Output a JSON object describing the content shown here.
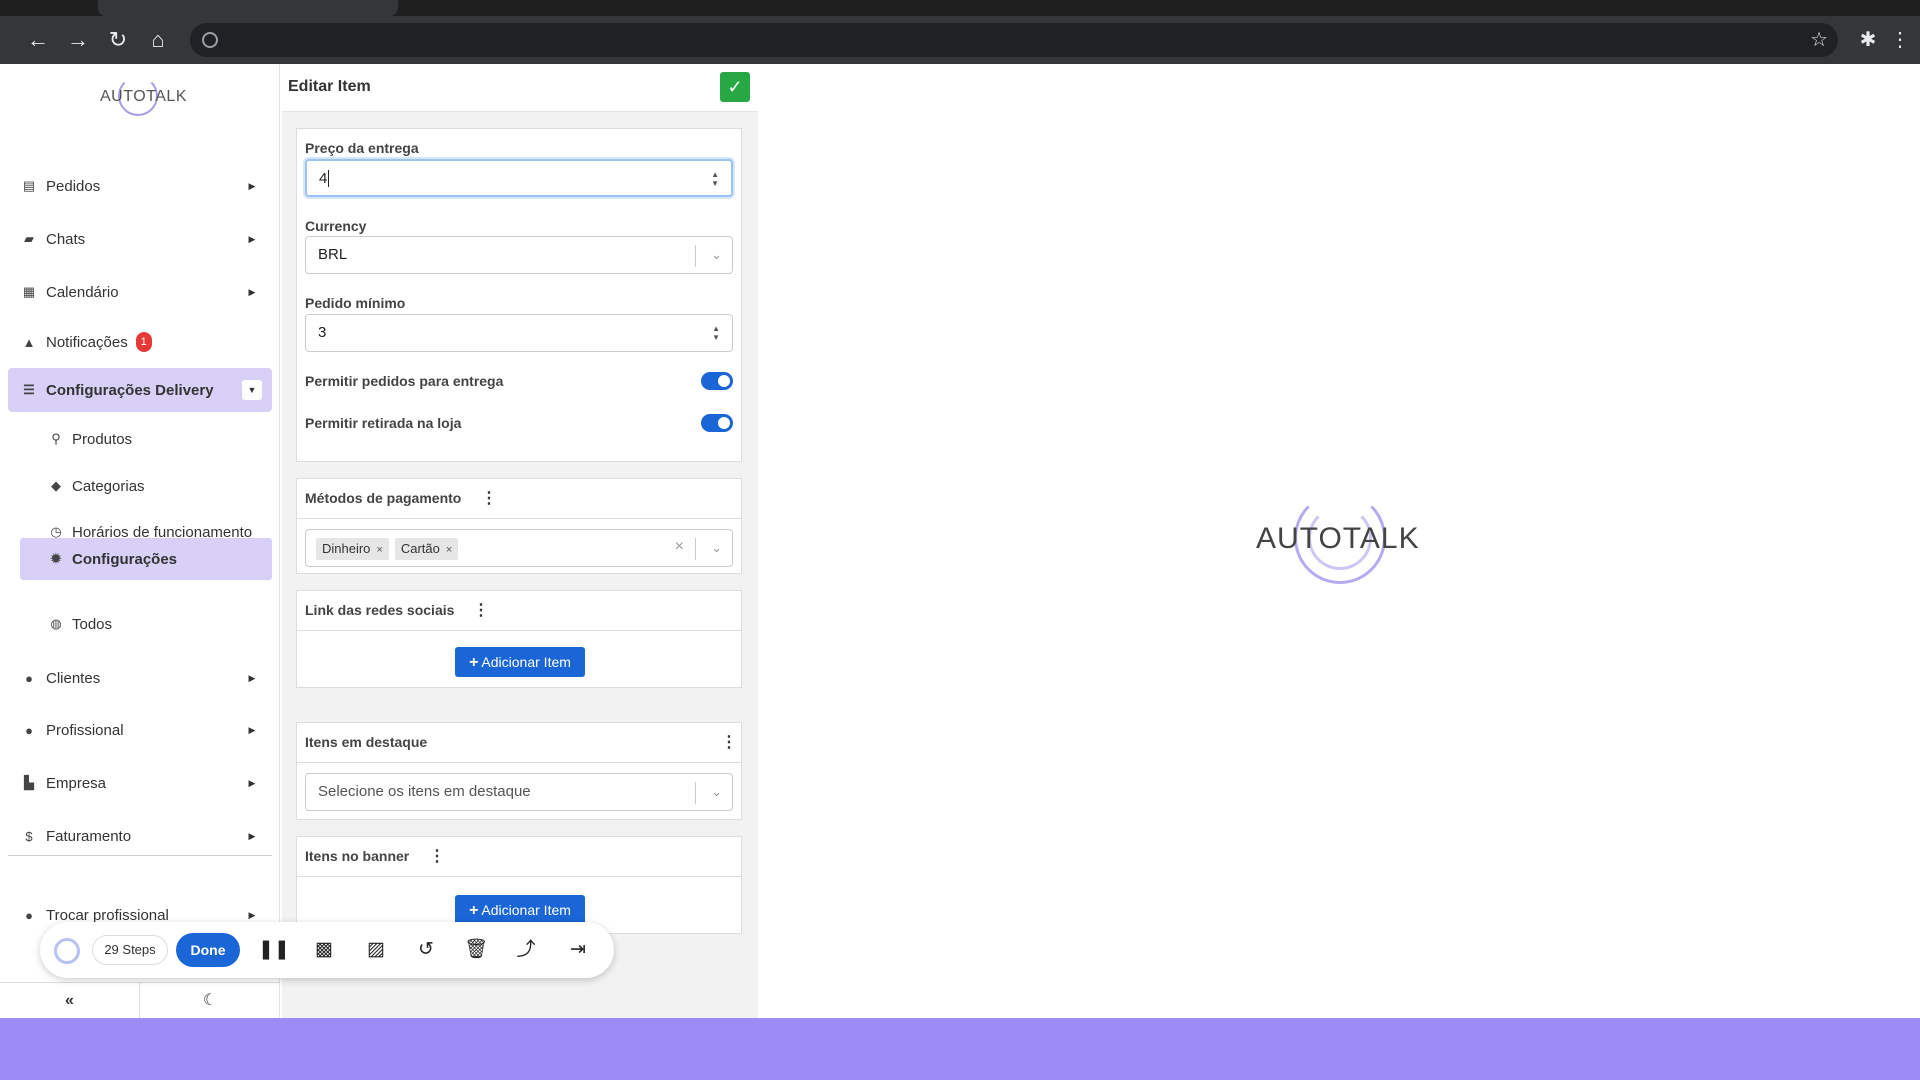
{
  "browser": {
    "back": "←",
    "forward": "→",
    "reload": "↻",
    "home": "⌂",
    "bookmark_star": "☆",
    "extensions": "✱",
    "menu": "⋮"
  },
  "sidebar": {
    "logo_text": "AUTOTALK",
    "items": [
      {
        "label": "Pedidos",
        "icon": "clipboard-icon"
      },
      {
        "label": "Chats",
        "icon": "chat-icon"
      },
      {
        "label": "Calendário",
        "icon": "calendar-icon"
      },
      {
        "label": "Notificações",
        "icon": "bell-icon",
        "badge": "1"
      },
      {
        "label": "Configurações Delivery",
        "icon": "sliders-icon"
      },
      {
        "label": "Clientes",
        "icon": "users-icon"
      },
      {
        "label": "Profissional",
        "icon": "user-gear-icon"
      },
      {
        "label": "Empresa",
        "icon": "building-icon"
      },
      {
        "label": "Faturamento",
        "icon": "dollar-icon"
      },
      {
        "label": "Trocar profissional",
        "icon": "users-swap-icon"
      }
    ],
    "sub_items": [
      {
        "label": "Produtos",
        "icon": "pepper-icon"
      },
      {
        "label": "Categorias",
        "icon": "tag-icon"
      },
      {
        "label": "Horários de funcionamento",
        "icon": "clock-icon"
      },
      {
        "label": "Configurações",
        "icon": "gear-icon"
      },
      {
        "label": "Todos",
        "icon": "globe-icon"
      }
    ],
    "collapse_label": "«",
    "theme_label": "☾"
  },
  "form": {
    "title": "Editar Item",
    "delivery_price": {
      "label": "Preço da entrega",
      "value": "4"
    },
    "currency": {
      "label": "Currency",
      "value": "BRL"
    },
    "min_order": {
      "label": "Pedido mínimo",
      "value": "3"
    },
    "allow_delivery": {
      "label": "Permitir pedidos para entrega",
      "on": true
    },
    "allow_pickup": {
      "label": "Permitir retirada na loja",
      "on": true
    },
    "payment_methods": {
      "label": "Métodos de pagamento",
      "tags": [
        "Dinheiro",
        "Cartão"
      ],
      "clear": "×"
    },
    "social_links": {
      "label": "Link das redes sociais",
      "add_label": "Adicionar Item"
    },
    "featured": {
      "label": "Itens em destaque",
      "placeholder": "Selecione os itens em destaque"
    },
    "banner": {
      "label": "Itens no banner",
      "add_label": "Adicionar Item"
    }
  },
  "preview": {
    "logo_text": "AUTOTALK"
  },
  "recorder": {
    "steps": "29 Steps",
    "done": "Done"
  },
  "colors": {
    "accent": "#1a66d6",
    "active_bg": "#d8d0f7",
    "success": "#28a745",
    "band": "#9d8cf7"
  }
}
